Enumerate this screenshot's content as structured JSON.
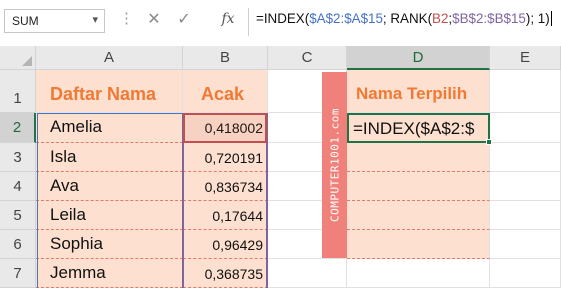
{
  "formula_bar": {
    "name_box": "SUM",
    "name_box_dropdown_icon": "chevron-down-icon",
    "more_icon": "vertical-dots-icon",
    "cancel_icon": "close-icon",
    "enter_icon": "check-icon",
    "fx_label": "fx",
    "formula_parts": [
      "=INDEX(",
      "$A$2:$A$15",
      "; RANK(",
      "B2",
      ";",
      "$B$2:$B$15",
      "); 1)"
    ]
  },
  "columns": [
    "A",
    "B",
    "C",
    "D",
    "E"
  ],
  "active_column": "D",
  "rows": [
    "1",
    "2",
    "3",
    "4",
    "5",
    "6",
    "7"
  ],
  "active_row": "2",
  "headers": {
    "names": "Daftar Nama",
    "random": "Acak",
    "selected": "Nama Terpilih"
  },
  "names": [
    "Amelia",
    "Isla",
    "Ava",
    "Leila",
    "Sophia",
    "Jemma"
  ],
  "values": [
    "0,418002",
    "0,720191",
    "0,836734",
    "0,17644",
    "0,96429",
    "0,368735"
  ],
  "active_cell_text": "=INDEX($A$2:$",
  "watermark": "COMPUTER1001.com",
  "colors": {
    "peach": "#fde0cf",
    "header_orange": "#f07a35",
    "watermark_bg": "#f0817a",
    "excel_green": "#217346",
    "ref_blue": "#4472c4",
    "ref_red": "#c0504d",
    "ref_purple": "#8064a2"
  }
}
